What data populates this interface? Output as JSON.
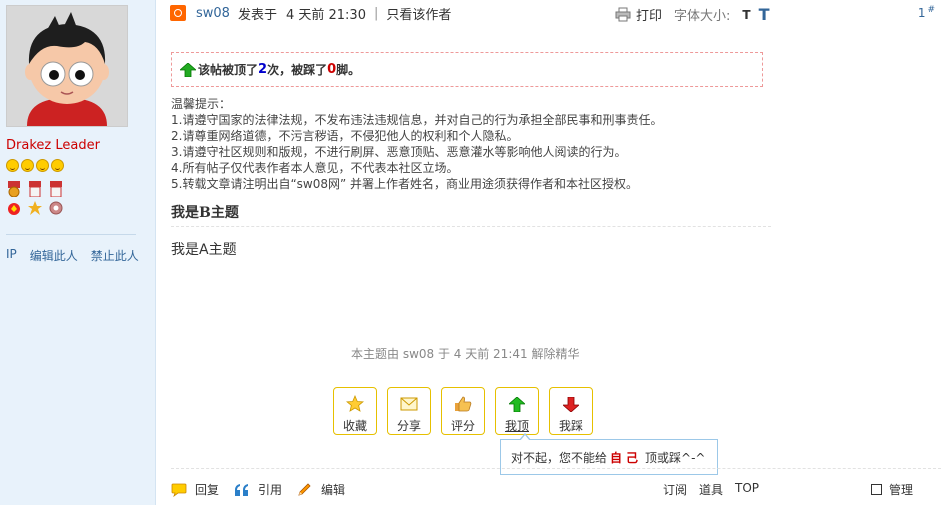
{
  "sidebar": {
    "username": "Drakez Leader",
    "links": [
      "IP",
      "编辑此人",
      "禁止此人"
    ]
  },
  "post": {
    "author": "sw08",
    "posted_label": "发表于",
    "time": "4 天前 21:30",
    "separator": "|",
    "only_author": "只看该作者",
    "print": "打印",
    "font_size_label": "字体大小:",
    "font_small": "T",
    "font_large": "T",
    "floor": "1",
    "floor_mark": "#"
  },
  "topbox": {
    "part1": "该帖被顶了",
    "up_count": "2",
    "part2": "次，被踩了",
    "down_count": "0",
    "part3": "脚。"
  },
  "tips": {
    "title": "温馨提示：",
    "lines": [
      "1.请遵守国家的法律法规，不发布违法违规信息，并对自己的行为承担全部民事和刑事责任。",
      "2.请尊重网络道德，不污言秽语，不侵犯他人的权利和个人隐私。",
      "3.请遵守社区规则和版规，不进行刷屏、恶意顶贴、恶意灌水等影响他人阅读的行为。",
      "4.所有帖子仅代表作者本人意见，不代表本社区立场。",
      "5.转载文章请注明出自“sw08网” 并署上作者姓名，商业用途须获得作者和本社区授权。"
    ]
  },
  "content": {
    "subject_b": "我是B主题",
    "subject_a": "我是A主题",
    "mod_note": "本主题由 sw08 于 4 天前 21:41 解除精华"
  },
  "actions": {
    "favorite": "收藏",
    "share": "分享",
    "rate": "评分",
    "up": "我顶",
    "down": "我踩"
  },
  "tooltip": {
    "prefix": "对不起，您不能给",
    "emph": "自己",
    "suffix": "顶或踩^-^"
  },
  "footer": {
    "reply": "回复",
    "quote": "引用",
    "edit": "编辑",
    "subscribe": "订阅",
    "tools": "道具",
    "top": "TOP",
    "manage": "管理"
  }
}
